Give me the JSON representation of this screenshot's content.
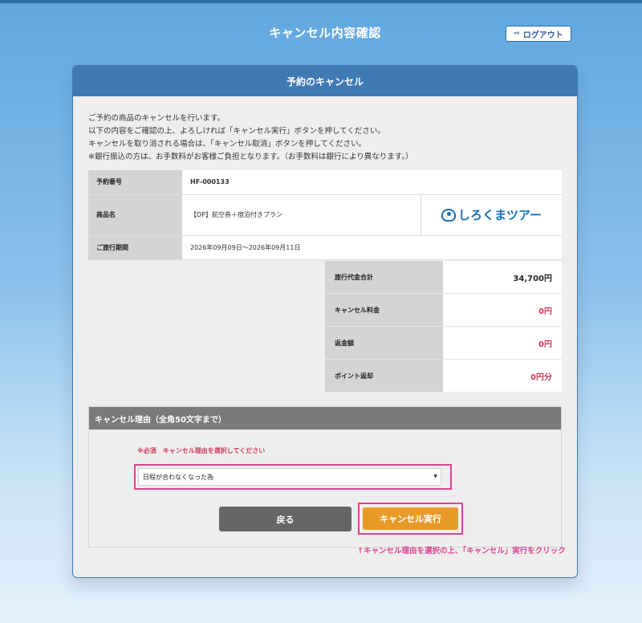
{
  "header": {
    "title": "キャンセル内容確認",
    "logout_label": "ログアウト",
    "logout_icon": "sign-out-icon"
  },
  "panel": {
    "title": "予約のキャンセル",
    "intro": [
      "ご予約の商品のキャンセルを行います。",
      "以下の内容をご確認の上、よろしければ「キャンセル実行」ボタンを押してください。",
      "キャンセルを取り消される場合は、「キャンセル取消」ボタンを押してください。",
      "※銀行振込の方は、お手数料がお客様ご負担となります。（お手数料は銀行により異なります。）"
    ]
  },
  "reservation": {
    "number_label": "予約番号",
    "number": "HF-000133",
    "product_label": "商品名",
    "product": "【DP】航空券＋宿泊付きプラン",
    "logo_text": "しろくまツアー",
    "period_label": "ご旅行期間",
    "period": "2026年09月09日～2026年09月11日"
  },
  "prices": [
    {
      "label": "旅行代金合計",
      "value": "34,700円",
      "color": "#222222"
    },
    {
      "label": "キャンセル料金",
      "value": "0円",
      "color": "#d03a5c"
    },
    {
      "label": "返金額",
      "value": "0円",
      "color": "#d03a5c"
    },
    {
      "label": "ポイント返却",
      "value": "0円分",
      "color": "#d03a5c"
    }
  ],
  "reason": {
    "title": "キャンセル理由（全角50文字まで）",
    "required_note": "※必須　キャンセル理由を選択してください",
    "selected": "日程が合わなくなった為"
  },
  "buttons": {
    "back": "戻る",
    "execute": "キャンセル実行"
  },
  "hint": "↑キャンセル理由を選択の上、「キャンセル」実行をクリック",
  "colors": {
    "accent": "#3f7ab5",
    "highlight": "#d94494",
    "execute": "#e79a28",
    "back": "#666666"
  }
}
